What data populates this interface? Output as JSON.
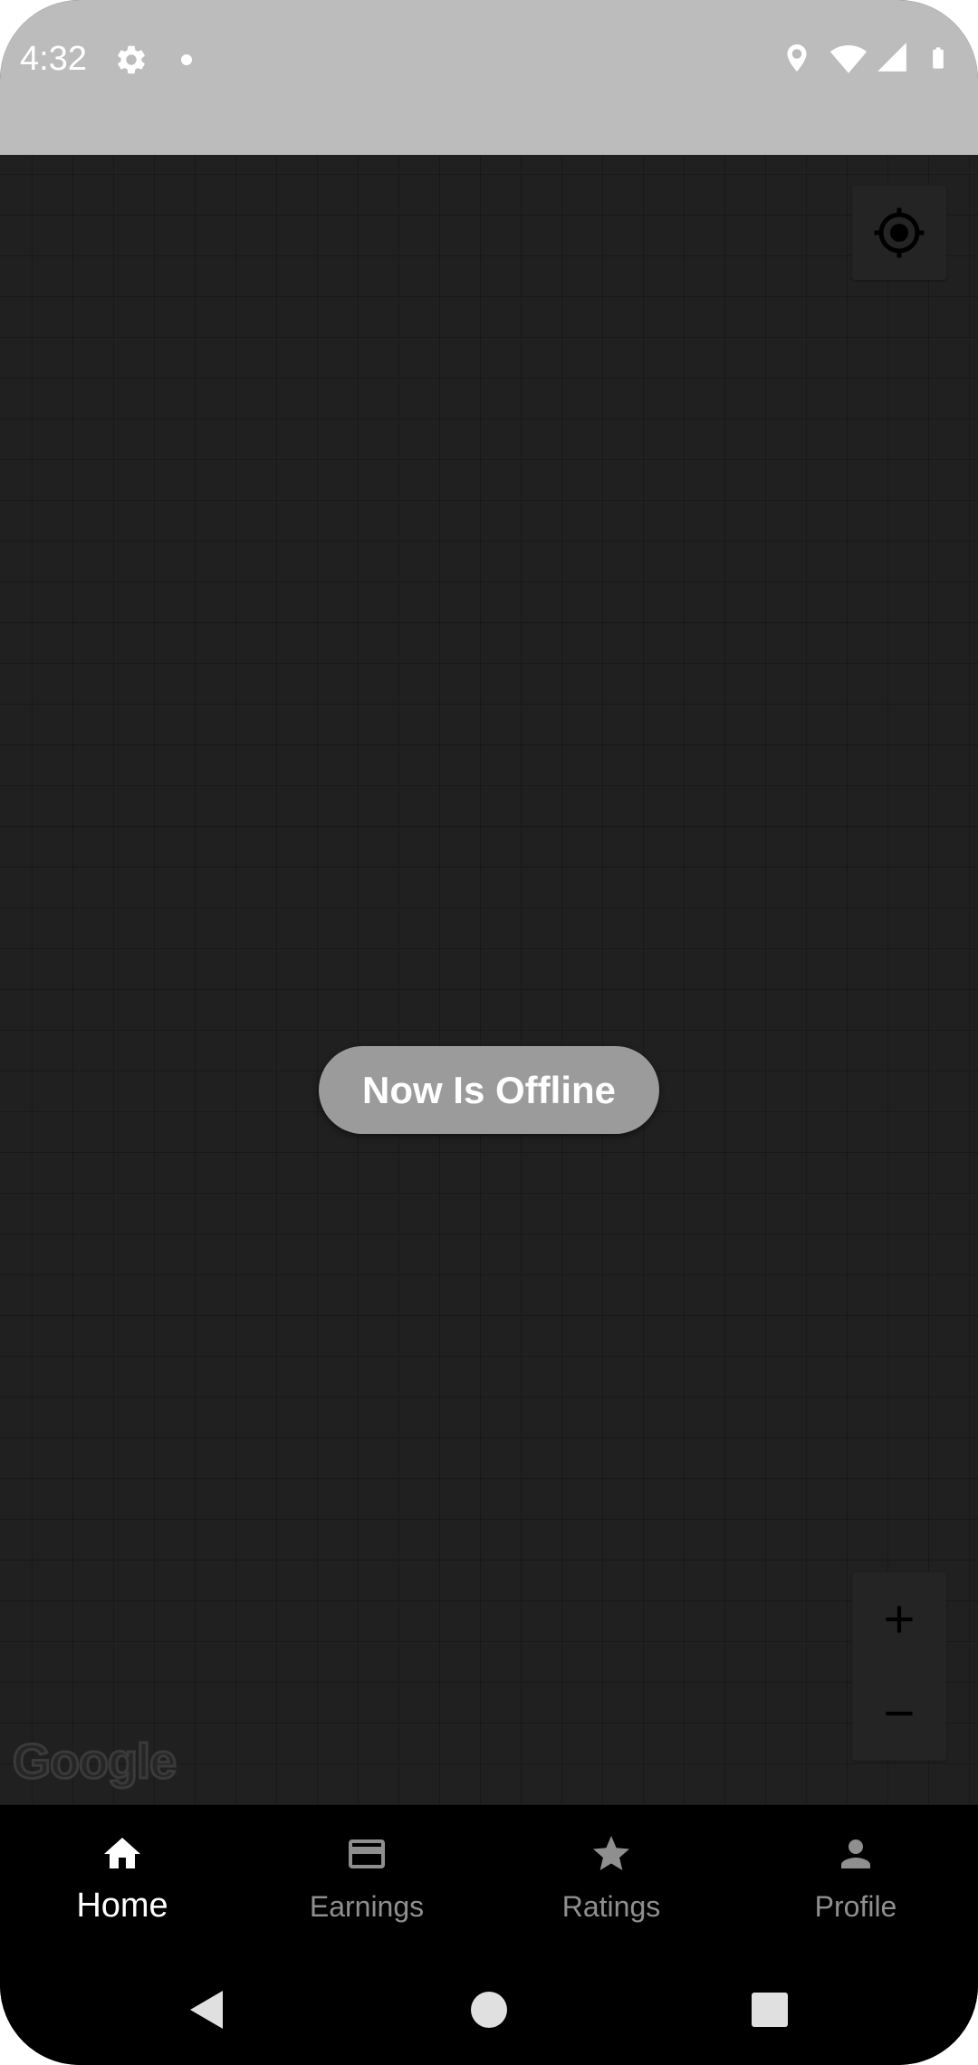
{
  "status_bar": {
    "time": "4:32",
    "icons": [
      "settings-icon",
      "notification-dot-icon",
      "location-icon",
      "wifi-icon",
      "cellular-signal-icon",
      "battery-icon"
    ]
  },
  "map": {
    "provider_logo": "Google",
    "controls": [
      "my-location-icon",
      "zoom-in-icon",
      "zoom-out-icon"
    ]
  },
  "status_button": {
    "label": "Now Is Offline"
  },
  "bottom_nav": {
    "items": [
      {
        "label": "Home",
        "icon": "home-icon",
        "active": true
      },
      {
        "label": "Earnings",
        "icon": "credit-card-icon",
        "active": false
      },
      {
        "label": "Ratings",
        "icon": "star-icon",
        "active": false
      },
      {
        "label": "Profile",
        "icon": "person-icon",
        "active": false
      }
    ]
  },
  "system_nav": {
    "buttons": [
      "back-icon",
      "home-circle-icon",
      "recents-icon"
    ]
  },
  "colors": {
    "status_bar_bg": "#bcbcbc",
    "map_bg": "#202020",
    "pill_bg": "#9b9b9b",
    "nav_bg": "#000000",
    "nav_active": "#ffffff",
    "nav_inactive": "#8f8f8f"
  }
}
